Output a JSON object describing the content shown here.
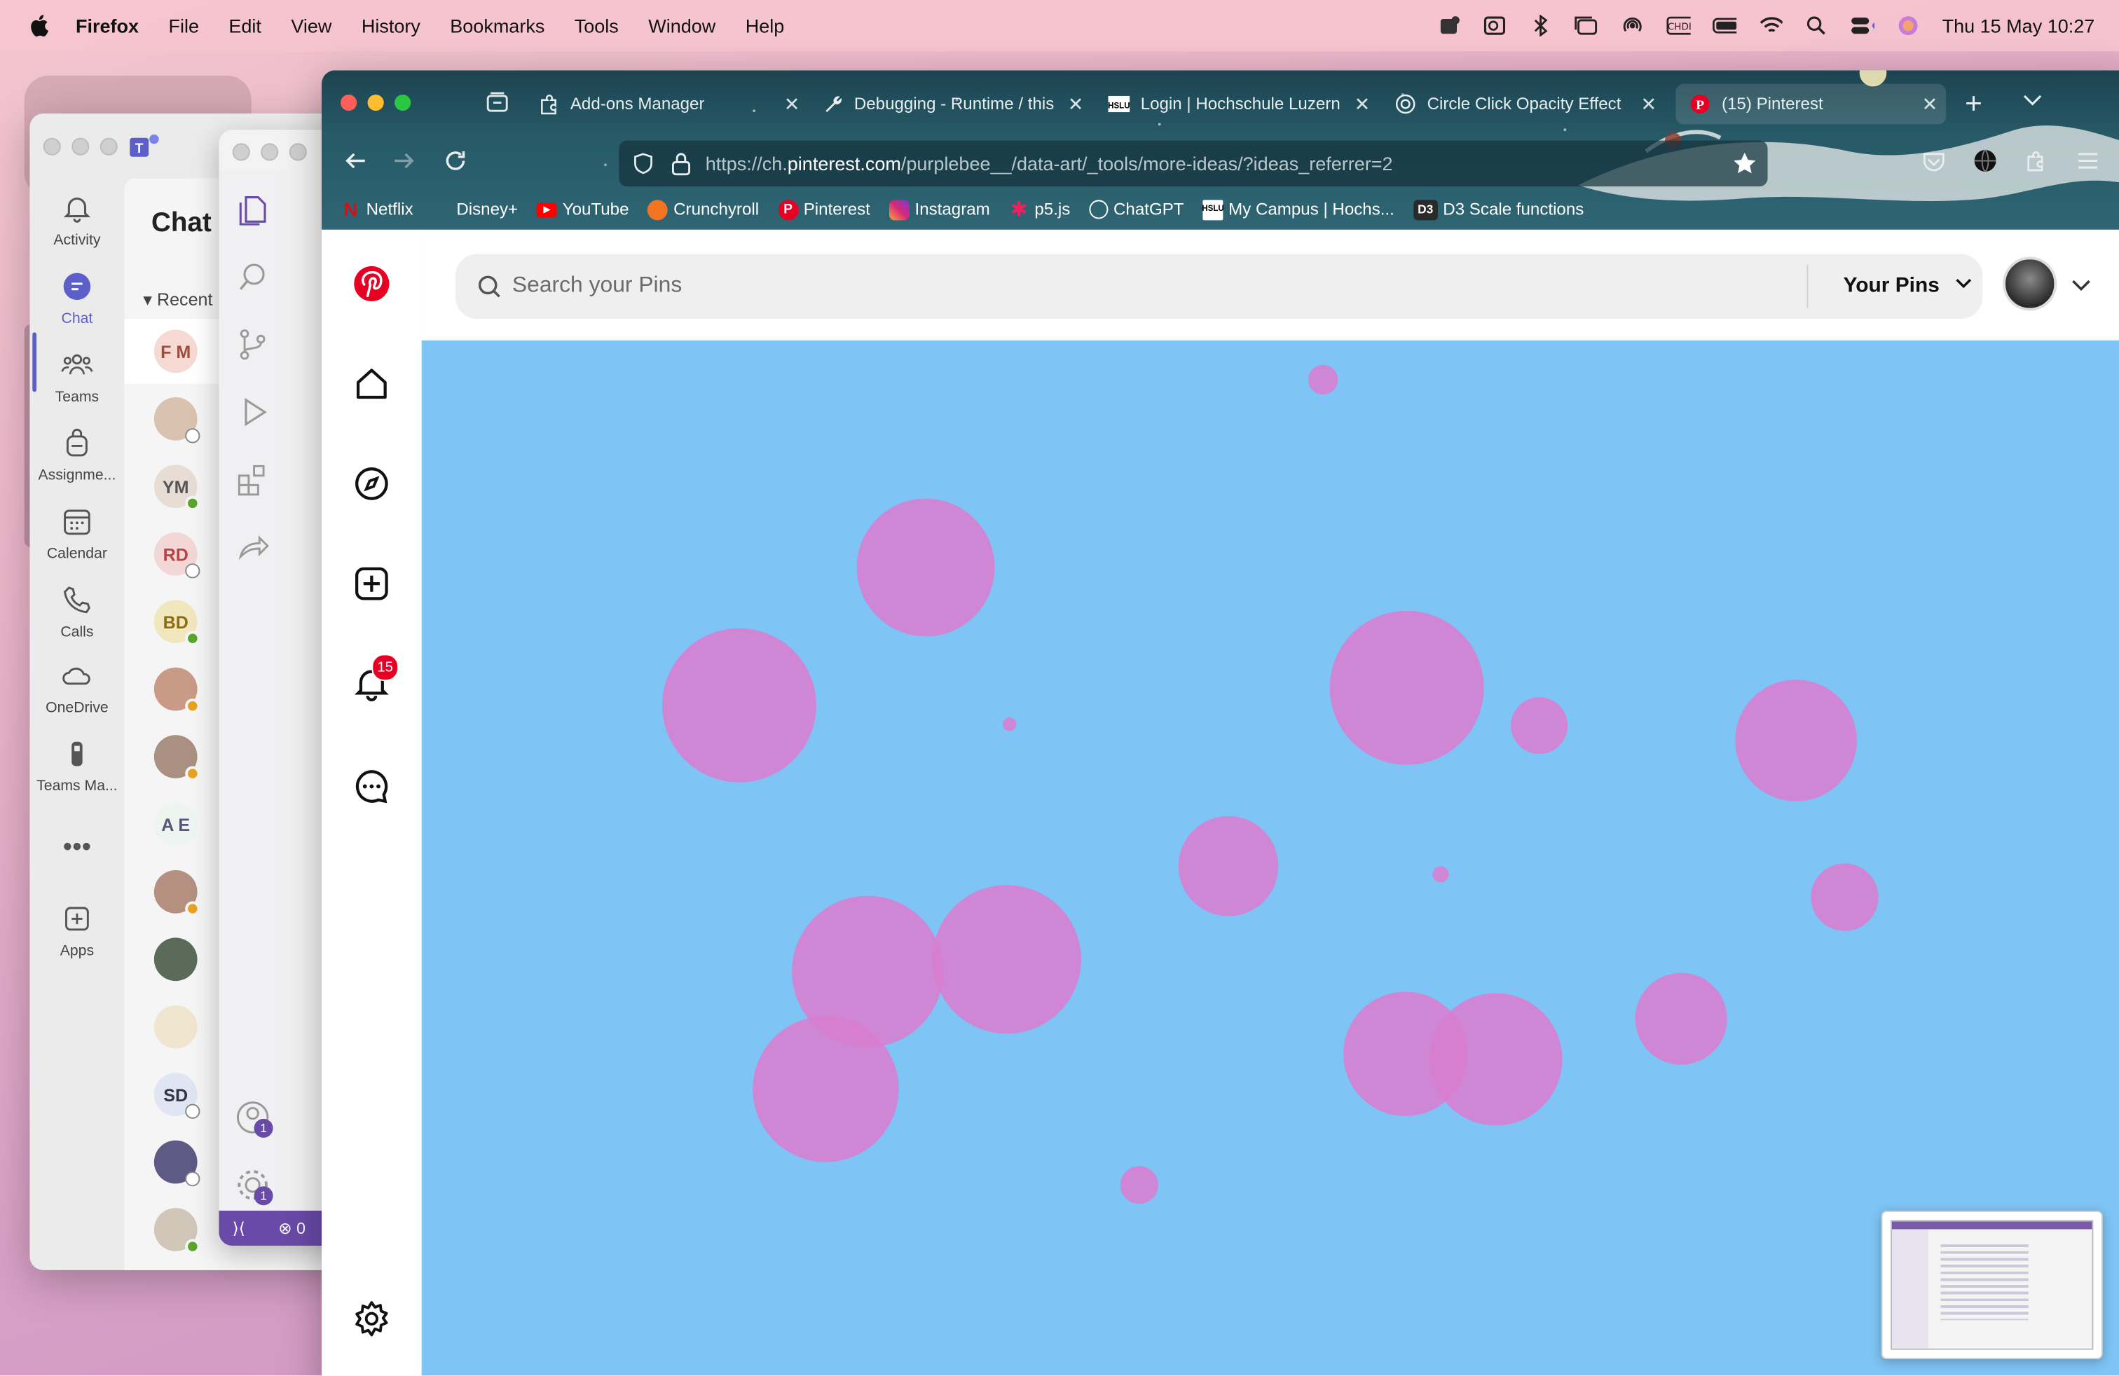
{
  "menubar": {
    "app": "Firefox",
    "menus": [
      "File",
      "Edit",
      "View",
      "History",
      "Bookmarks",
      "Tools",
      "Window",
      "Help"
    ],
    "datetime": "Thu 15 May  10:27"
  },
  "teams": {
    "rail": [
      "Activity",
      "Chat",
      "Teams",
      "Assignme...",
      "Calendar",
      "Calls",
      "OneDrive",
      "Teams Ma...",
      "Apps"
    ],
    "list_title": "Chat",
    "section": "Recent",
    "chats": [
      {
        "initials": "F M",
        "status": ""
      },
      {
        "initials": "",
        "status": "off"
      },
      {
        "initials": "YM",
        "status": "green"
      },
      {
        "initials": "RD",
        "status": "off"
      },
      {
        "initials": "BD",
        "status": "green"
      },
      {
        "initials": "",
        "status": "away"
      },
      {
        "initials": "",
        "status": "away"
      },
      {
        "initials": "A E",
        "status": ""
      },
      {
        "initials": "",
        "status": "away"
      },
      {
        "initials": "",
        "status": ""
      },
      {
        "initials": "",
        "status": ""
      },
      {
        "initials": "SD",
        "status": "off"
      },
      {
        "initials": "",
        "status": "off"
      },
      {
        "initials": "",
        "status": "green"
      }
    ]
  },
  "vscode": {
    "badges": [
      "1",
      "1"
    ],
    "status_errors": "0"
  },
  "firefox": {
    "tabs": [
      {
        "label": "Add-ons Manager",
        "icon": "puzzle-icon"
      },
      {
        "label": "Debugging - Runtime / this",
        "icon": "wrench-icon"
      },
      {
        "label": "Login | Hochschule Luzern",
        "icon": "hslu-icon"
      },
      {
        "label": "Circle Click Opacity Effect",
        "icon": "openai-icon"
      },
      {
        "label": "(15) Pinterest",
        "icon": "pinterest-icon"
      }
    ],
    "url_prefix": "https://ch.",
    "url_domain": "pinterest.com",
    "url_path": "/purplebee__/data-art/_tools/more-ideas/?ideas_referrer=2",
    "bookmarks": [
      "Netflix",
      "Disney+",
      "YouTube",
      "Crunchyroll",
      "Pinterest",
      "Instagram",
      "p5.js",
      "ChatGPT",
      "My Campus | Hochs...",
      "D3 Scale functions"
    ]
  },
  "pinterest": {
    "search_placeholder": "Search your Pins",
    "your_pins": "Your Pins",
    "notification_count": "15"
  },
  "colors": {
    "canvas_bg": "#7ec4f5",
    "circle": "#d97dd0",
    "pinterest_red": "#e60023",
    "teams_accent": "#5b5fc7"
  }
}
